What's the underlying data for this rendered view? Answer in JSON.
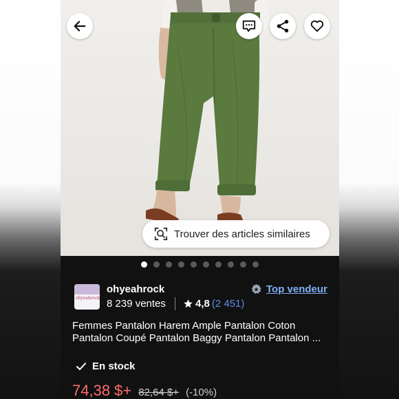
{
  "header_buttons": {
    "back_icon": "arrow-left-icon",
    "message_icon": "message-icon",
    "share_icon": "share-icon",
    "favorite_icon": "heart-icon"
  },
  "image": {
    "similar_button_label": "Trouver des articles similaires",
    "carousel_total": 10,
    "carousel_active": 1
  },
  "seller": {
    "logo_text": "ohyeahrock",
    "name": "ohyeahrock",
    "sales": "8 239 ventes",
    "rating": "4,8",
    "reviews": "(2 451)",
    "badge": "Top vendeur"
  },
  "product": {
    "title_line1": "Femmes Pantalon Harem Ample Pantalon Coton",
    "title_line2": "Pantalon Coupé Pantalon Baggy Pantalon Pantalon ...",
    "stock": "En stock",
    "price": "74,38 $+",
    "old_price": "82,64 $+",
    "discount": "(-10%)"
  },
  "colors": {
    "accent_link": "#7fb0f5",
    "price": "#ff6b6b",
    "pants": "#5a7a3e"
  }
}
